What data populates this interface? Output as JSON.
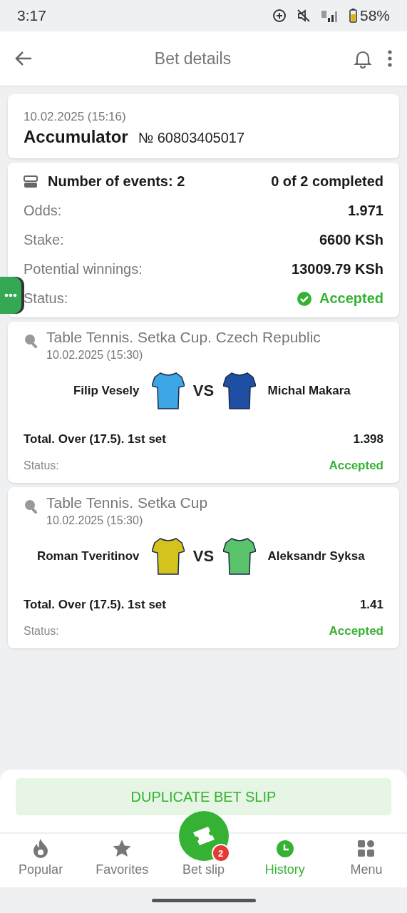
{
  "status_bar": {
    "time": "3:17",
    "battery": "58%"
  },
  "header": {
    "title": "Bet details"
  },
  "bet": {
    "date": "10.02.2025 (15:16)",
    "type": "Accumulator",
    "number": "№ 60803405017",
    "summary": {
      "events": "Number of events: 2",
      "completed": "0 of 2 completed"
    },
    "rows": [
      {
        "label": "Odds:",
        "value": "1.971"
      },
      {
        "label": "Stake:",
        "value": "6600 KSh"
      },
      {
        "label": "Potential winnings:",
        "value": "13009.79 KSh"
      }
    ],
    "status": {
      "label": "Status:",
      "value": "Accepted"
    }
  },
  "events": [
    {
      "title": "Table Tennis. Setka Cup. Czech Republic",
      "date": "10.02.2025 (15:30)",
      "home": {
        "name": "Filip Vesely",
        "color": "#3da7e6"
      },
      "vs": "VS",
      "away": {
        "name": "Michal Makara",
        "color": "#1f4fa3"
      },
      "market": "Total. Over (17.5). 1st set",
      "odds": "1.398",
      "status_label": "Status:",
      "status": "Accepted"
    },
    {
      "title": "Table Tennis. Setka Cup",
      "date": "10.02.2025 (15:30)",
      "home": {
        "name": "Roman Tveritinov",
        "color": "#d4c21e"
      },
      "vs": "VS",
      "away": {
        "name": "Aleksandr Syksa",
        "color": "#5bc36a"
      },
      "market": "Total. Over (17.5). 1st set",
      "odds": "1.41",
      "status_label": "Status:",
      "status": "Accepted"
    }
  ],
  "duplicate_button": "DUPLICATE BET SLIP",
  "nav": [
    {
      "kind": "popular",
      "label": "Popular",
      "selected": false
    },
    {
      "kind": "favorites",
      "label": "Favorites",
      "selected": false
    },
    {
      "kind": "betslip",
      "label": "Bet slip",
      "badge": "2",
      "selected": false
    },
    {
      "kind": "history",
      "label": "History",
      "selected": true
    },
    {
      "kind": "menu",
      "label": "Menu",
      "selected": false
    }
  ]
}
